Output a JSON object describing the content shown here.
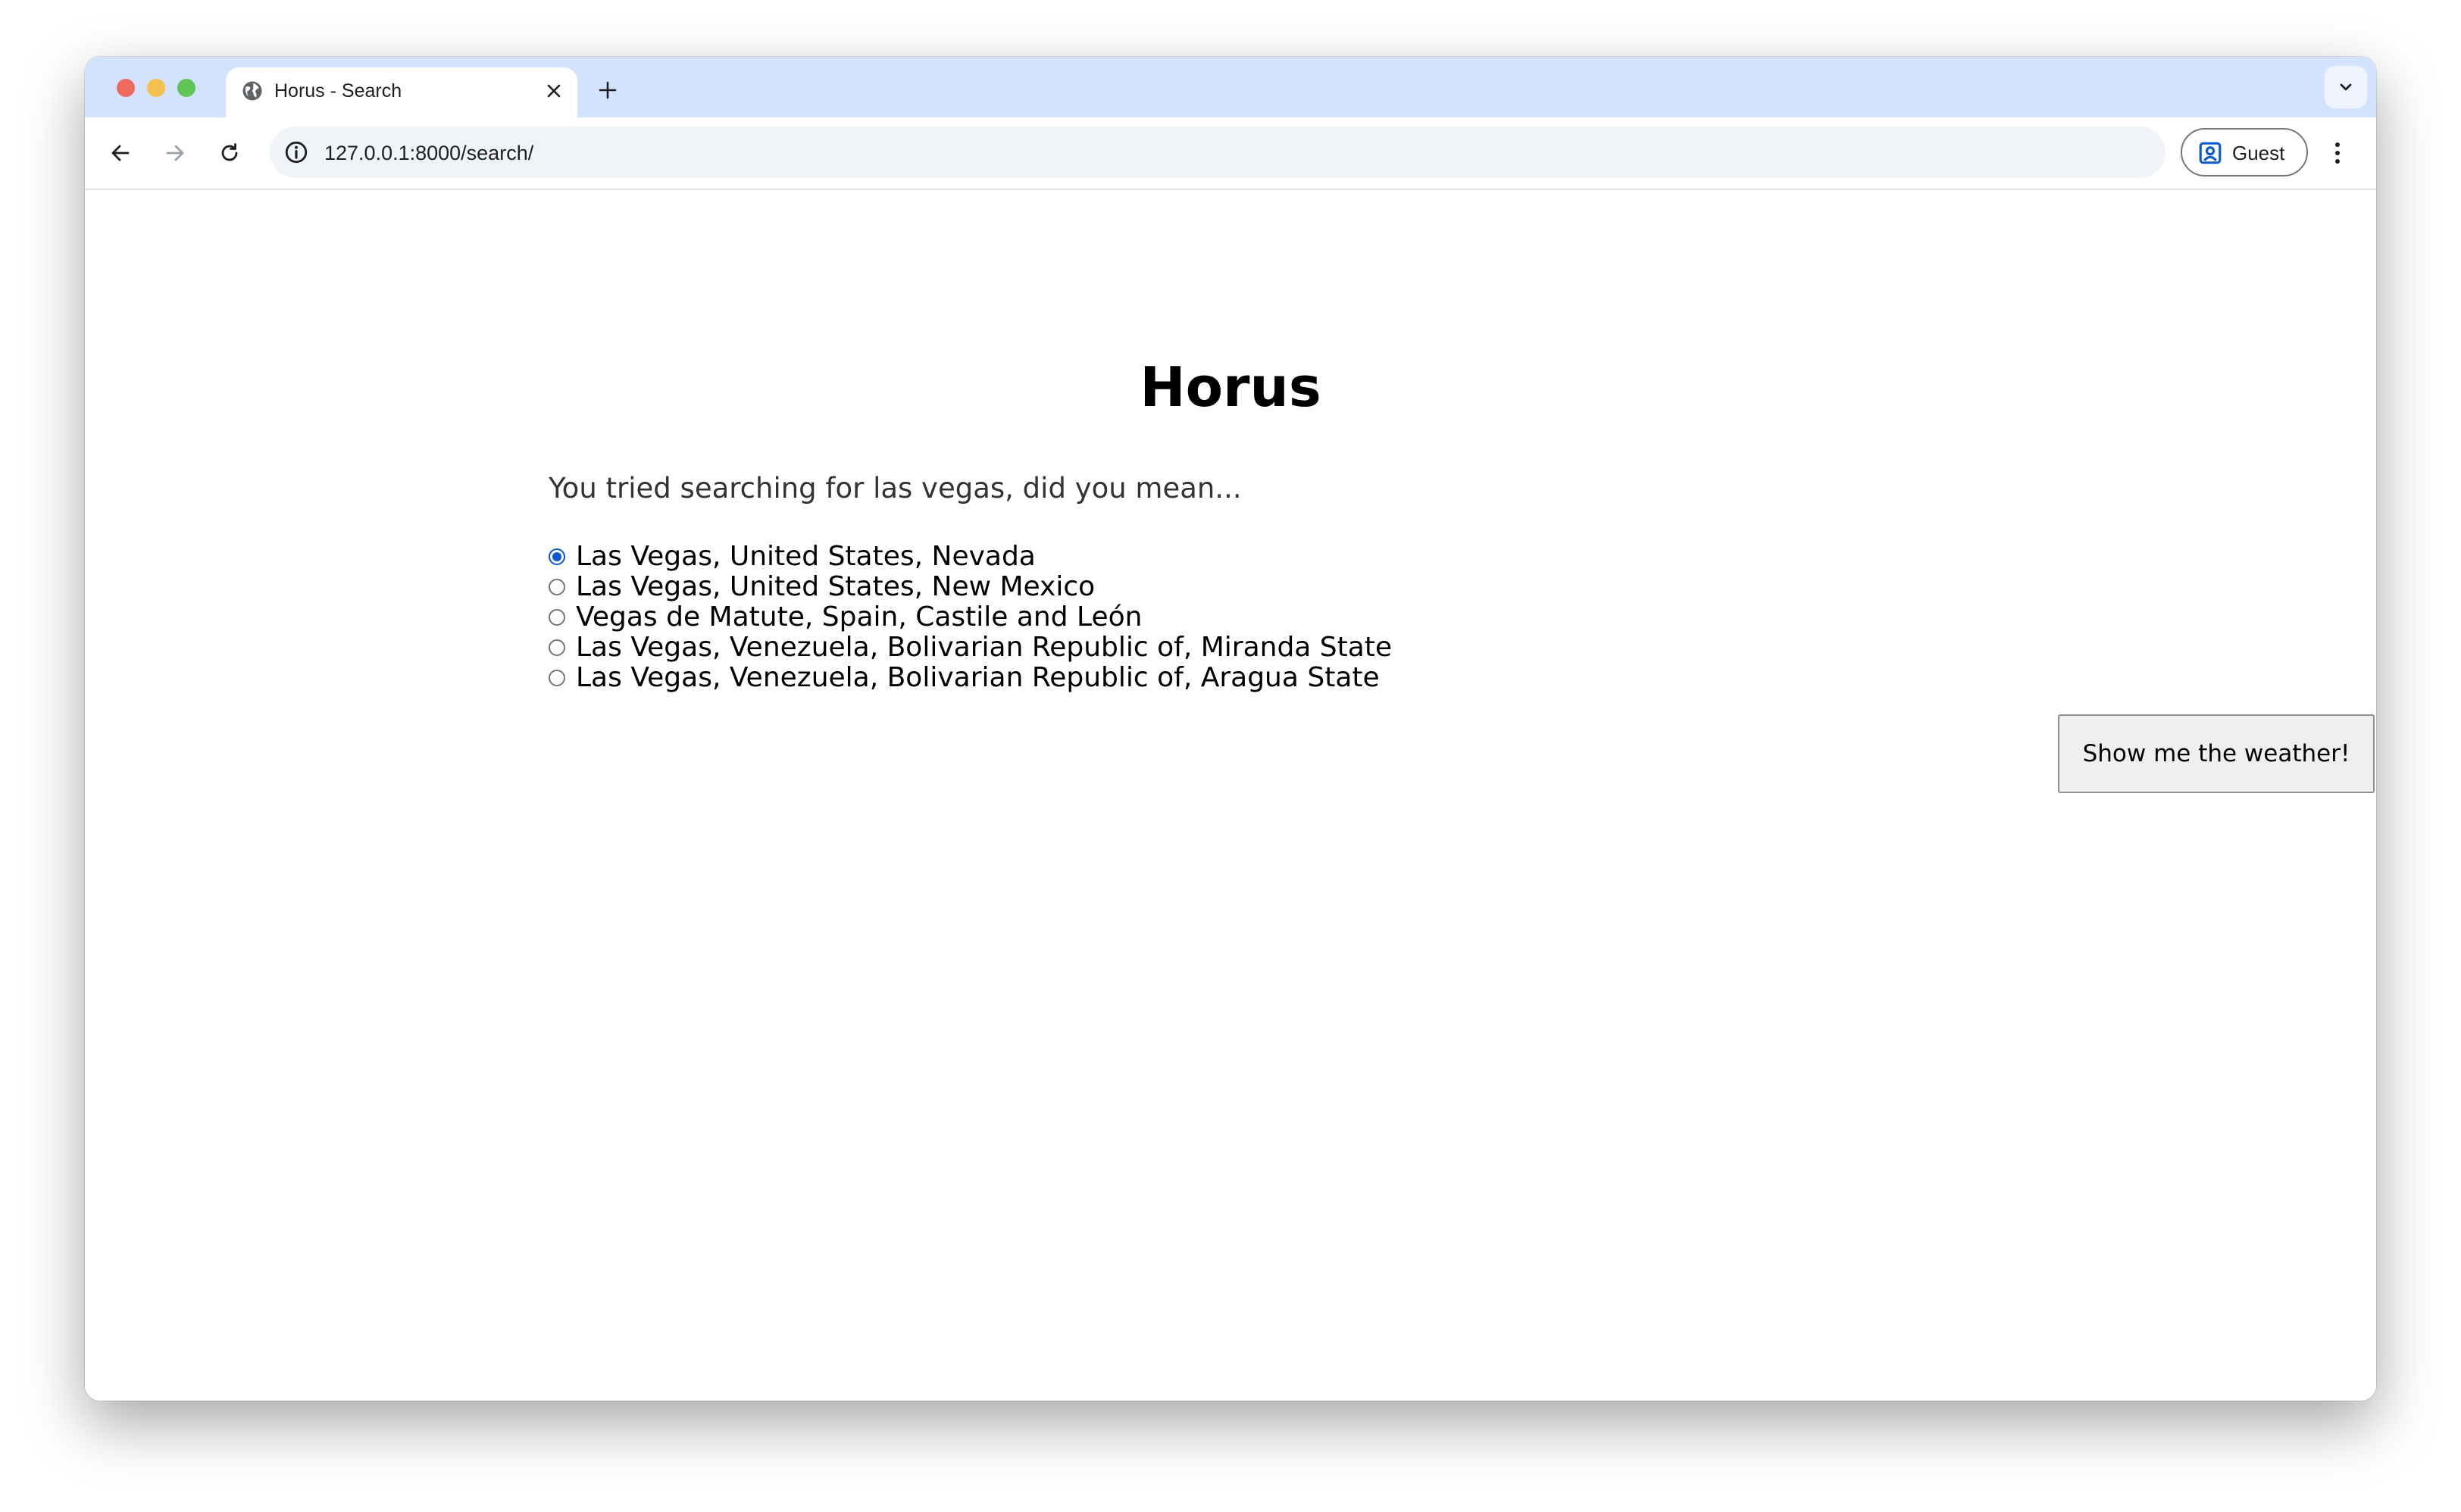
{
  "browser": {
    "tab": {
      "title": "Horus - Search",
      "favicon": "globe-icon"
    },
    "address_bar": {
      "url": "127.0.0.1:8000/search/"
    },
    "profile": {
      "label": "Guest"
    }
  },
  "page": {
    "heading": "Horus",
    "prompt": "You tried searching for las vegas, did you mean...",
    "options": [
      {
        "label": "Las Vegas, United States, Nevada",
        "selected": true
      },
      {
        "label": "Las Vegas, United States, New Mexico",
        "selected": false
      },
      {
        "label": "Vegas de Matute, Spain, Castile and León",
        "selected": false
      },
      {
        "label": "Las Vegas, Venezuela, Bolivarian Republic of, Miranda State",
        "selected": false
      },
      {
        "label": "Las Vegas, Venezuela, Bolivarian Republic of, Aragua State",
        "selected": false
      }
    ],
    "submit_label": "Show me the weather!"
  },
  "colors": {
    "tabstrip": "#d3e3fd",
    "radio_selected": "#0b57d0"
  }
}
